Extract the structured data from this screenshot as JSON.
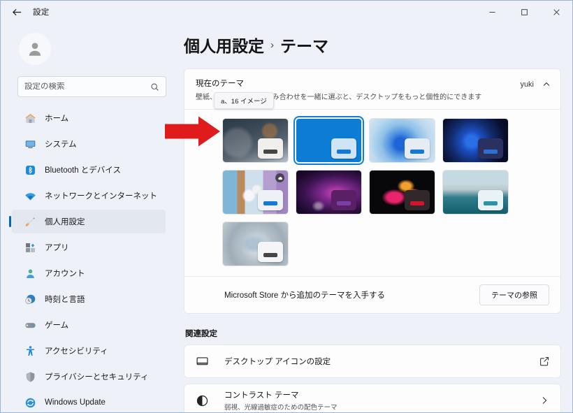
{
  "window": {
    "title": "設定",
    "back_label": "back-arrow",
    "controls": {
      "minimize": "–",
      "maximize": "□",
      "close": "✕"
    }
  },
  "sidebar": {
    "search": {
      "placeholder": "設定の検索",
      "value": ""
    },
    "items": [
      {
        "label": "ホーム",
        "icon": "home-icon",
        "active": false
      },
      {
        "label": "システム",
        "icon": "system-icon",
        "active": false
      },
      {
        "label": "Bluetooth とデバイス",
        "icon": "bluetooth-icon",
        "active": false
      },
      {
        "label": "ネットワークとインターネット",
        "icon": "network-icon",
        "active": false
      },
      {
        "label": "個人用設定",
        "icon": "personalization-icon",
        "active": true
      },
      {
        "label": "アプリ",
        "icon": "apps-icon",
        "active": false
      },
      {
        "label": "アカウント",
        "icon": "accounts-icon",
        "active": false
      },
      {
        "label": "時刻と言語",
        "icon": "time-language-icon",
        "active": false
      },
      {
        "label": "ゲーム",
        "icon": "gaming-icon",
        "active": false
      },
      {
        "label": "アクセシビリティ",
        "icon": "accessibility-icon",
        "active": false
      },
      {
        "label": "プライバシーとセキュリティ",
        "icon": "privacy-icon",
        "active": false
      },
      {
        "label": "Windows Update",
        "icon": "windows-update-icon",
        "active": false
      }
    ]
  },
  "main": {
    "breadcrumb": {
      "parent": "個人用設定",
      "separator": "›",
      "current": "テーマ"
    },
    "current_theme_card": {
      "title": "現在のテーマ",
      "subtitle": "壁紙、サウンド、色の組み合わせを一緒に選ぶと、デスクトップをもっと個性的にできます",
      "user": "yuki",
      "expand_chevron": "chevron-up-icon",
      "tooltip": "a、16 イメージ",
      "themes": [
        {
          "name": "winter-forest-theme",
          "selected": false,
          "widget": "light",
          "bar": "#454545"
        },
        {
          "name": "windows-blue-theme",
          "selected": true,
          "widget": "lightblue",
          "bar": "#1479d6"
        },
        {
          "name": "windows-light-bloom-theme",
          "selected": false,
          "widget": "light",
          "bar": "#1479d6"
        },
        {
          "name": "windows-dark-bloom-theme",
          "selected": false,
          "widget": "dark",
          "bar": "#2f6fd0"
        },
        {
          "name": "collage-spring-theme",
          "selected": false,
          "widget": "light",
          "bar": "#1479d6",
          "badge": "cloud-icon"
        },
        {
          "name": "purple-glow-theme",
          "selected": false,
          "widget": "darkpurple",
          "bar": "#7a3fa5"
        },
        {
          "name": "black-flower-theme",
          "selected": false,
          "widget": "dark",
          "bar": "#d3142d"
        },
        {
          "name": "teal-landscape-theme",
          "selected": false,
          "widget": "light",
          "bar": "#2a93a5"
        },
        {
          "name": "grey-flow-theme",
          "selected": false,
          "widget": "light",
          "bar": "#454545"
        }
      ],
      "store_text": "Microsoft Store から追加のテーマを入手する",
      "browse_button": "テーマの参照"
    },
    "related_section": {
      "title": "関連設定",
      "items": [
        {
          "title": "デスクトップ アイコンの設定",
          "subtitle": "",
          "icon": "monitor-icon",
          "end_icon": "external-link-icon"
        },
        {
          "title": "コントラスト テーマ",
          "subtitle": "弱視、光線過敏症のための配色テーマ",
          "icon": "contrast-icon",
          "end_icon": "chevron-right-icon"
        }
      ]
    }
  },
  "annotation": {
    "arrow": "red-right-arrow",
    "points_to": "winter-forest-theme"
  },
  "colors": {
    "accent": "#0067c0",
    "selection_ring": "#0a7fe0",
    "window_bg": "#eef1f8",
    "card_bg": "#fdfdfd",
    "annotation_red": "#e01b1b"
  }
}
